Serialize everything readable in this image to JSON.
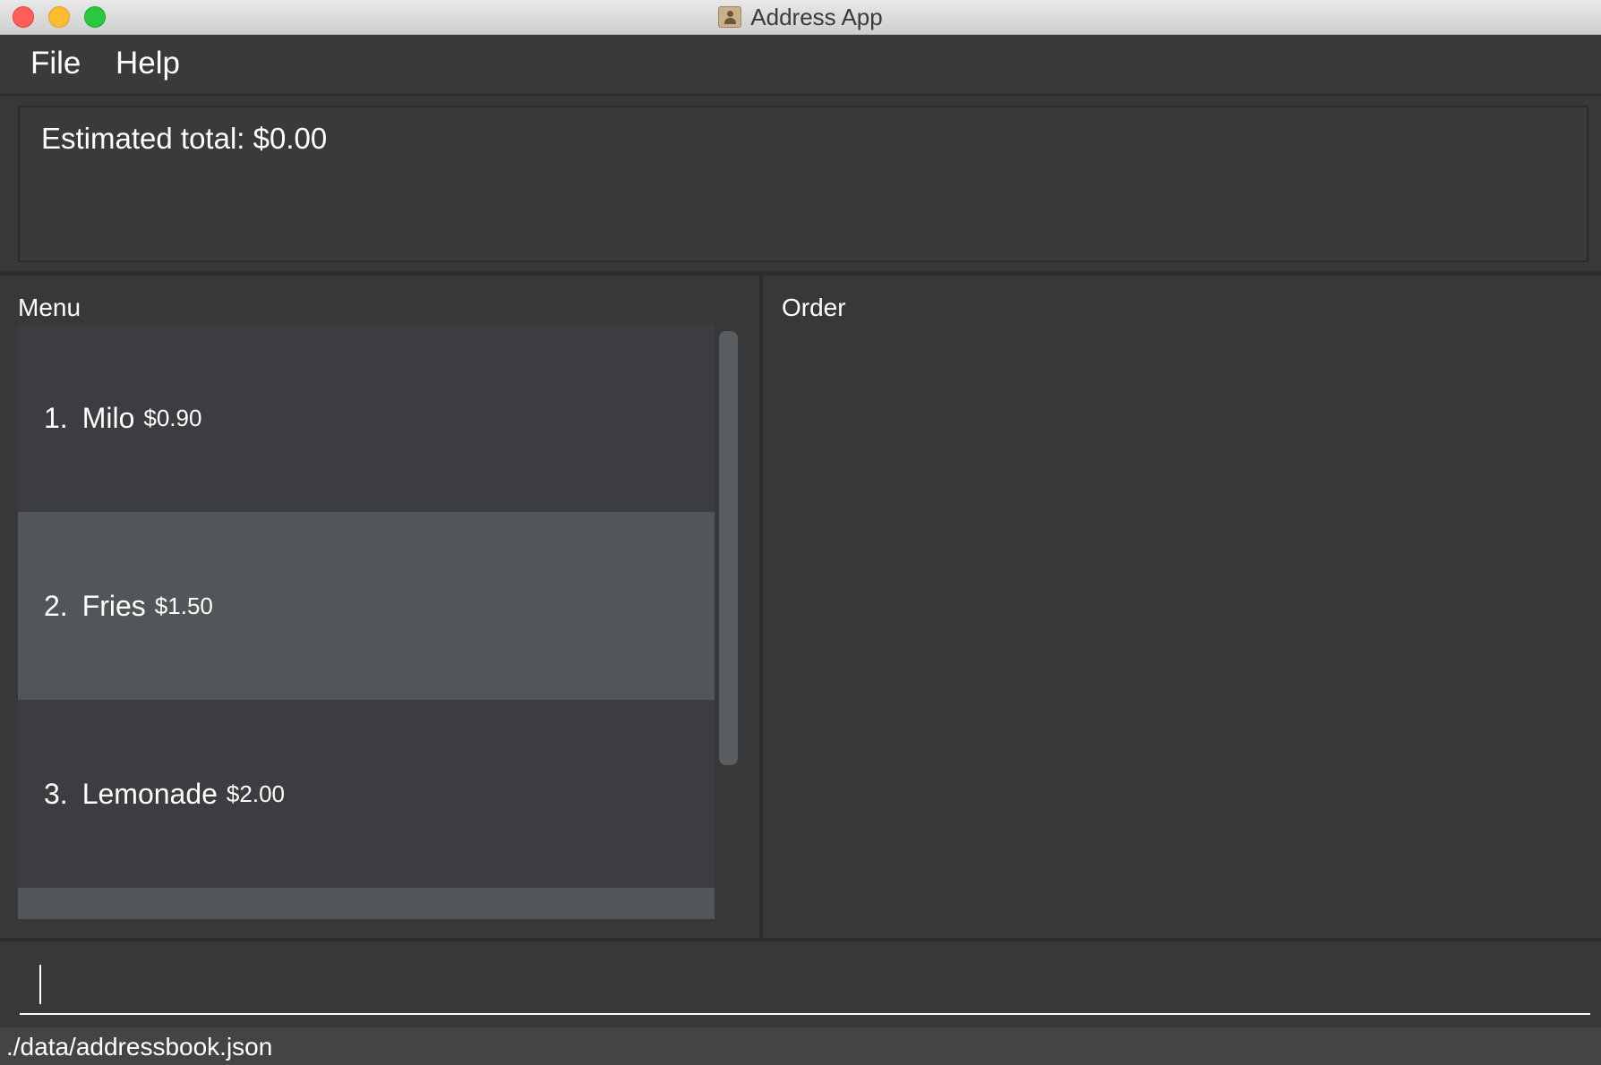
{
  "window": {
    "title": "Address App"
  },
  "menubar": {
    "file": "File",
    "help": "Help"
  },
  "result": {
    "text": "Estimated total: $0.00"
  },
  "menu_panel": {
    "label": "Menu",
    "items": [
      {
        "index": "1.",
        "name": "Milo",
        "price": "$0.90"
      },
      {
        "index": "2.",
        "name": "Fries",
        "price": "$1.50"
      },
      {
        "index": "3.",
        "name": "Lemonade",
        "price": "$2.00"
      }
    ]
  },
  "order_panel": {
    "label": "Order"
  },
  "command": {
    "value": ""
  },
  "status": {
    "file_path": "./data/addressbook.json"
  },
  "colors": {
    "background": "#383838",
    "row_dark": "#3c3d40",
    "row_light": "#515658",
    "status_bar": "#444444"
  }
}
